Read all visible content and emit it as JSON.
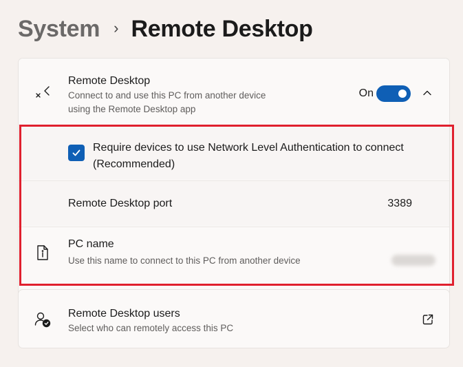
{
  "breadcrumb": {
    "parent": "System",
    "separator": "›",
    "current": "Remote Desktop"
  },
  "remote_desktop": {
    "icon": "remote-desktop-icon",
    "title": "Remote Desktop",
    "description": "Connect to and use this PC from another device using the Remote Desktop app",
    "toggle_label": "On",
    "toggle_state": true,
    "expanded": true
  },
  "nla": {
    "checked": true,
    "label": "Require devices to use Network Level Authentication to connect (Recommended)"
  },
  "port": {
    "label": "Remote Desktop port",
    "value": "3389"
  },
  "pc_name": {
    "icon": "pc-info-icon",
    "title": "PC name",
    "description": "Use this name to connect to this PC from another device"
  },
  "users": {
    "icon": "users-check-icon",
    "title": "Remote Desktop users",
    "description": "Select who can remotely access this PC"
  },
  "colors": {
    "accent": "#0f5fb5",
    "highlight": "#e0202e",
    "background": "#f6f1ee",
    "card": "#fbf9f8"
  }
}
